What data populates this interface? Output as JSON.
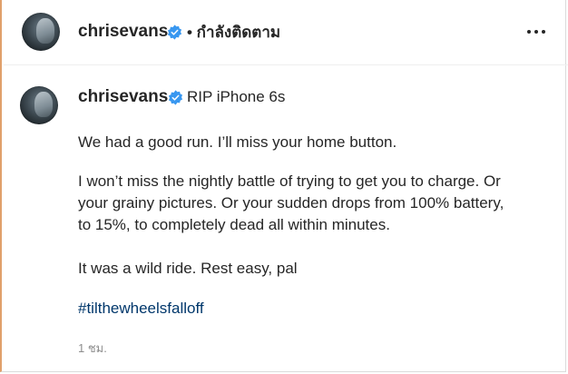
{
  "header": {
    "username": "chrisevans",
    "follow_status": "• กำลังติดตาม",
    "avatar_icon": "profile-avatar",
    "verified_icon": "verified-badge-icon",
    "more_icon": "more-options-icon"
  },
  "post": {
    "username": "chrisevans",
    "caption_title": "RIP iPhone 6s",
    "paragraph1": "We had a good run. I’ll miss your home button.",
    "paragraph2": "I won’t miss the nightly battle of trying to get you to charge. Or\nyour grainy pictures. Or your sudden drops from 100% battery,\nto 15%, to completely dead all within minutes.",
    "paragraph3": "It was a wild ride. Rest easy, pal",
    "hashtag": "#tilthewheelsfalloff",
    "timestamp": "1 ชม."
  },
  "colors": {
    "verified": "#3897f0",
    "hashtag": "#00376b",
    "text": "#262626",
    "muted": "#8e8e8e"
  }
}
